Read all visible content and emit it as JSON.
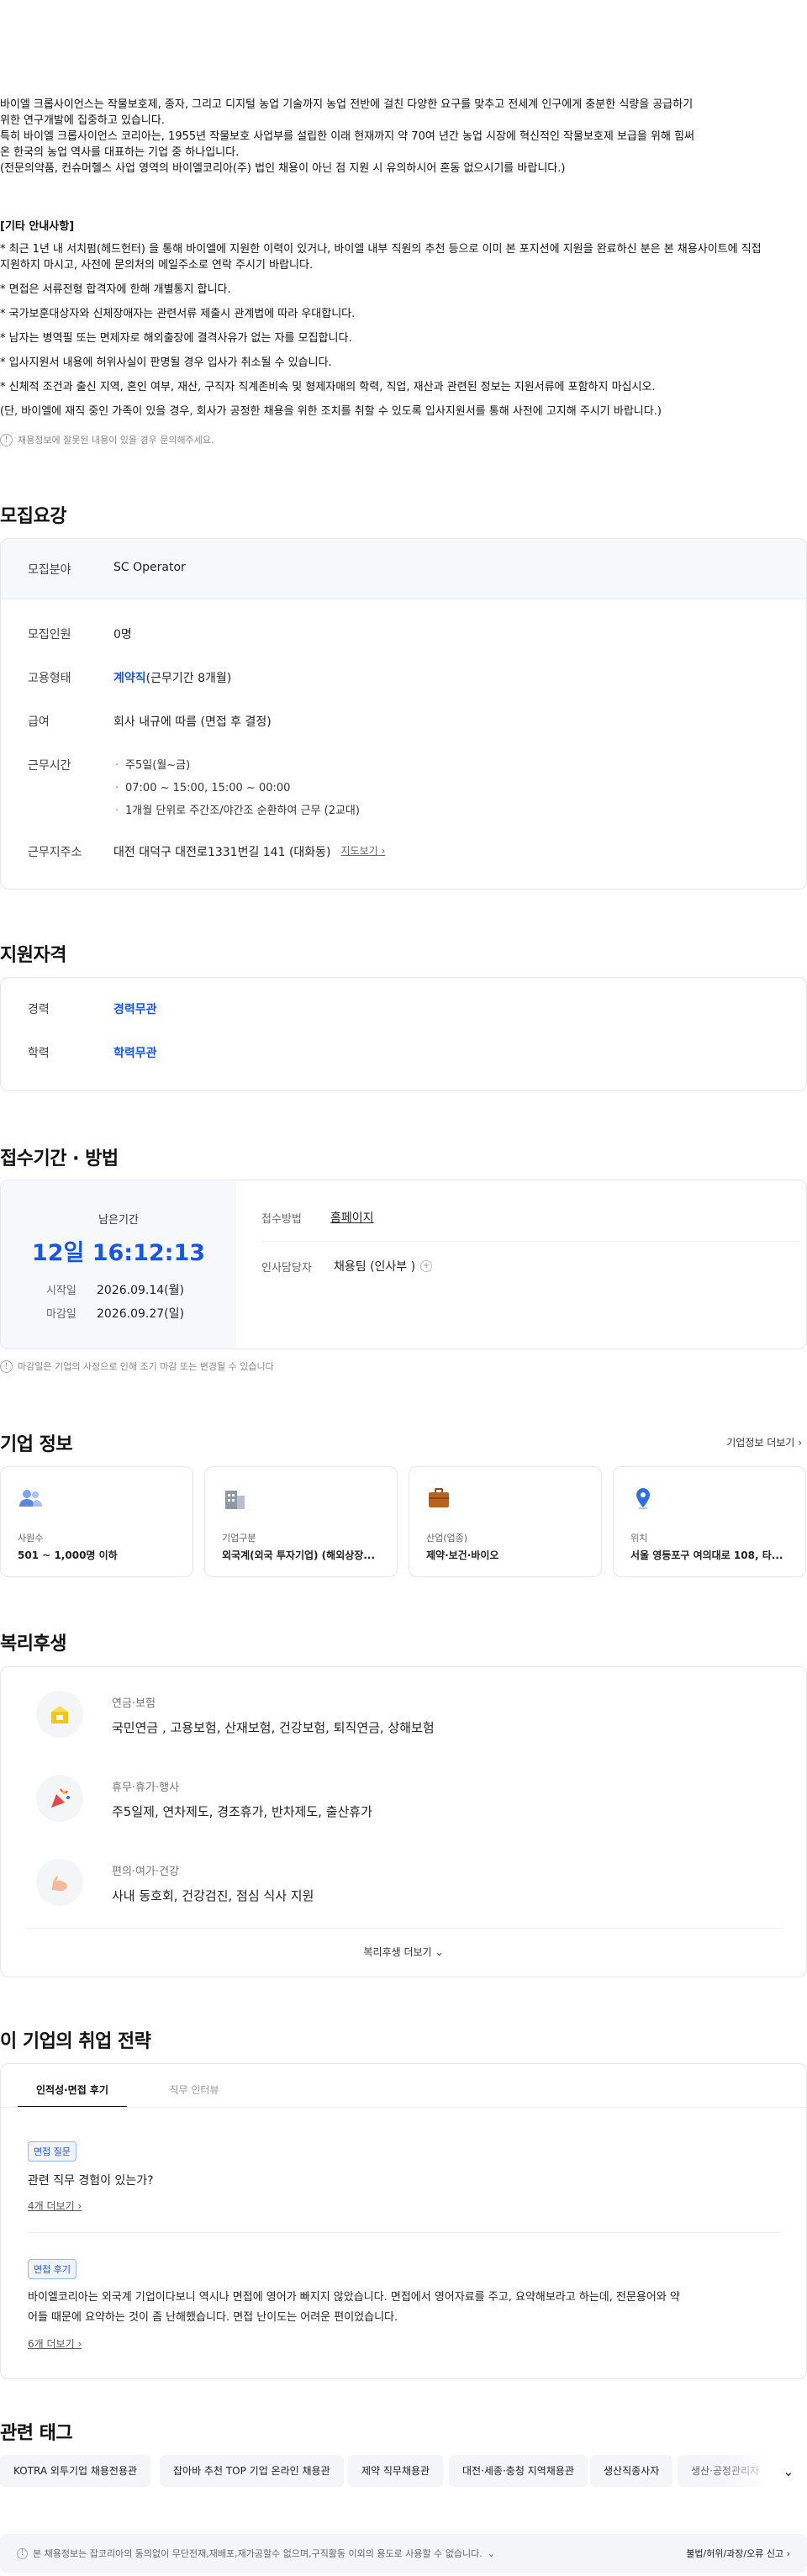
{
  "description": {
    "lines": [
      "바이엘 크롭사이언스는 작물보호제, 종자, 그리고 디지털 농업 기술까지 농업 전반에 걸친 다양한 요구를 맞추고 전세계 인구에게 충분한 식량을 공급하기",
      "위한 연구개발에 집중하고 있습니다.",
      "특히 바이엘 크롭사이언스 코리아는, 1955년 작물보호 사업부를 설립한 이래 현재까지 약 70여 년간 농업 시장에 혁신적인 작물보호제 보급을 위해 힘써",
      "온 한국의 농업 역사를 대표하는 기업 중 하나입니다.",
      "(전문의약품, 컨슈머헬스 사업 영역의 바이엘코리아(주) 법인 채용이 아닌 점 지원 시 유의하시어 혼동 없으시기를 바랍니다.)"
    ],
    "other_heading": "[기타 안내사항]",
    "bullets": [
      "* 최근 1년 내 서치펌(헤드헌터) 을 통해 바이엘에 지원한 이력이 있거나, 바이엘 내부 직원의 추천 등으로 이미 본 포지션에 지원을 완료하신 분은 본 채용사이트에 직접",
      "지원하지 마시고, 사전에 문의처의 메일주소로 연락 주시기 바랍니다.",
      "* 면접은 서류전형 합격자에 한해 개별통지 합니다.",
      "* 국가보훈대상자와 신체장애자는 관련서류 제출시 관계법에 따라 우대합니다.",
      "* 남자는 병역필 또는 면제자로 해외출장에 결격사유가 없는 자를 모집합니다.",
      "* 입사지원서 내용에 허위사실이 판명될 경우 입사가 취소될 수 있습니다.",
      "* 신체적 조건과 출신 지역, 혼인 여부, 재산, 구직자 직계존비속 및 형제자매의 학력, 직업, 재산과 관련된 정보는 지원서류에 포함하지 마십시오.",
      "(단, 바이엘에 재직 중인 가족이 있을 경우, 회사가 공정한 채용을 위한 조치를 취할 수 있도록 입사지원서를 통해 사전에 고지해 주시기 바랍니다.)"
    ],
    "note": "채용정보에 잘못된 내용이 있을 경우 문의해주세요."
  },
  "requirements": {
    "title": "모집요강",
    "field_label": "모집분야",
    "field_value": "SC Operator",
    "headcount_label": "모집인원",
    "headcount_value": "0명",
    "type_label": "고용형태",
    "type_value_strong": "계약직",
    "type_value_rest": "(근무기간 8개월)",
    "salary_label": "급여",
    "salary_value": "회사 내규에 따름 (면접 후 결정)",
    "hours_label": "근무시간",
    "hours_items": [
      "주5일(월~금)",
      "07:00 ~ 15:00, 15:00 ~ 00:00",
      "1개월 단위로 주간조/야간조 순환하여 근무 (2교대)"
    ],
    "location_label": "근무지주소",
    "location_value": "대전 대덕구 대전로1331번길 141 (대화동)",
    "map_link": "지도보기"
  },
  "qualification": {
    "title": "지원자격",
    "exp_label": "경력",
    "exp_value": "경력무관",
    "edu_label": "학력",
    "edu_value": "학력무관"
  },
  "apply": {
    "title": "접수기간 · 방법",
    "remain_label": "남은기간",
    "remain_value": "12일 16:12:13",
    "start_label": "시작일",
    "start_value": "2026.09.14(월)",
    "end_label": "마감일",
    "end_value": "2026.09.27(일)",
    "method_label": "접수방법",
    "method_value": "홈페이지",
    "hr_label": "인사담당자",
    "hr_value": "채용팀 (인사부 )",
    "note": "마감일은 기업의 사정으로 인해 조기 마감 또는 변경될 수 있습니다"
  },
  "company": {
    "title": "기업 정보",
    "more": "기업정보 더보기",
    "cards": [
      {
        "label": "사원수",
        "value": "501 ~ 1,000명 이하",
        "icon": "people-icon"
      },
      {
        "label": "기업구분",
        "value": "외국계(외국 투자기업) (해외상장...",
        "icon": "building-icon"
      },
      {
        "label": "산업(업종)",
        "value": "제약·보건·바이오",
        "icon": "briefcase-icon"
      },
      {
        "label": "위치",
        "value": "서울 영등포구 여의대로 108, 타...",
        "icon": "location-pin-icon"
      }
    ]
  },
  "benefits": {
    "title": "복리후생",
    "items": [
      {
        "category": "연금·보험",
        "value": "국민연금 , 고용보험, 산재보험, 건강보험, 퇴직연금, 상해보험"
      },
      {
        "category": "휴무·휴가·행사",
        "value": "주5일제, 연차제도, 경조휴가, 반차제도, 출산휴가"
      },
      {
        "category": "편의·여가·건강",
        "value": "사내 동호회, 건강검진, 점심 식사 지원"
      }
    ],
    "more": "복리후생 더보기"
  },
  "strategy": {
    "title": "이 기업의 취업 전략",
    "tabs": [
      "인적성·면접 후기",
      "직무 인터뷰"
    ],
    "q_badge": "면접 질문",
    "q_text": "관련 직무 경험이 있는가?",
    "q_more": "4개 더보기",
    "r_badge": "면접 후기",
    "r_text1": "바이엘코리아는 외국계 기업이다보니 역시나 면접에 영어가 빠지지 않았습니다. 면접에서 영어자료를 주고, 요약해보라고 하는데, 전문용어와 약",
    "r_text2": "어들 때문에 요약하는 것이 좀 난해했습니다. 면접 난이도는 어려운 편이었습니다.",
    "r_more": "6개 더보기"
  },
  "tags": {
    "title": "관련 태그",
    "items": [
      "KOTRA 외투기업 채용전용관",
      "잡아바 추천 TOP 기업 온라인 채용관",
      "제약 직무채용관",
      "대전·세종·충청 지역채용관",
      "생산직종사자",
      "생산·공정관리자"
    ]
  },
  "footer": {
    "notice": "본 채용정보는 잡코리아의 동의없이 무단전재,재배포,재가공할수 없으며,구직활동 이외의 용도로 사용할 수 없습니다.",
    "report": "불법/허위/과장/오류 신고"
  }
}
